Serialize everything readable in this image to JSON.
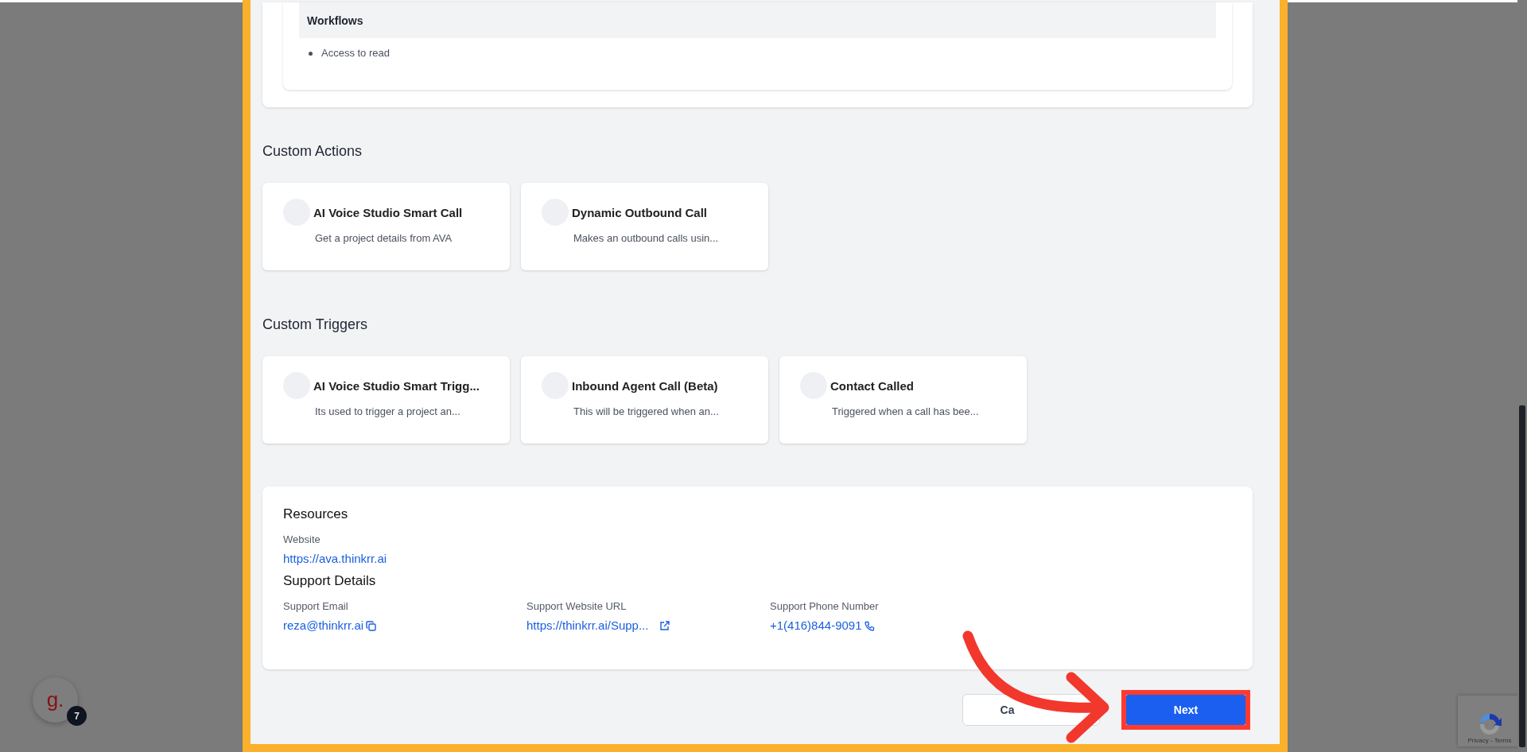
{
  "permissions_card": {
    "section_title": "Workflows",
    "items": [
      "Access to read"
    ]
  },
  "custom_actions": {
    "title": "Custom Actions",
    "items": [
      {
        "name": "AI Voice Studio Smart Call",
        "description": "Get a project details from AVA"
      },
      {
        "name": "Dynamic Outbound Call",
        "description": "Makes an outbound calls usin..."
      }
    ]
  },
  "custom_triggers": {
    "title": "Custom Triggers",
    "items": [
      {
        "name": "AI Voice Studio Smart Trigg...",
        "description": "Its used to trigger a project an..."
      },
      {
        "name": "Inbound Agent Call (Beta)",
        "description": "This will be triggered when an..."
      },
      {
        "name": "Contact Called",
        "description": "Triggered when a call has bee..."
      }
    ]
  },
  "resources": {
    "title": "Resources",
    "website_label": "Website",
    "website": "https://ava.thinkrr.ai",
    "support_title": "Support Details",
    "support": [
      {
        "label": "Support Email",
        "value": "reza@thinkrr.ai",
        "kind": "email"
      },
      {
        "label": "Support Website URL",
        "value": "https://thinkrr.ai/Supp...",
        "kind": "url"
      },
      {
        "label": "Support Phone Number",
        "value": "+1(416)844-9091",
        "kind": "phone"
      }
    ]
  },
  "footer": {
    "cancel": "Ca",
    "next": "Next"
  },
  "widget": {
    "logo": "g.",
    "badge": "7"
  },
  "recaptcha": {
    "text": "Privacy - Terms"
  }
}
